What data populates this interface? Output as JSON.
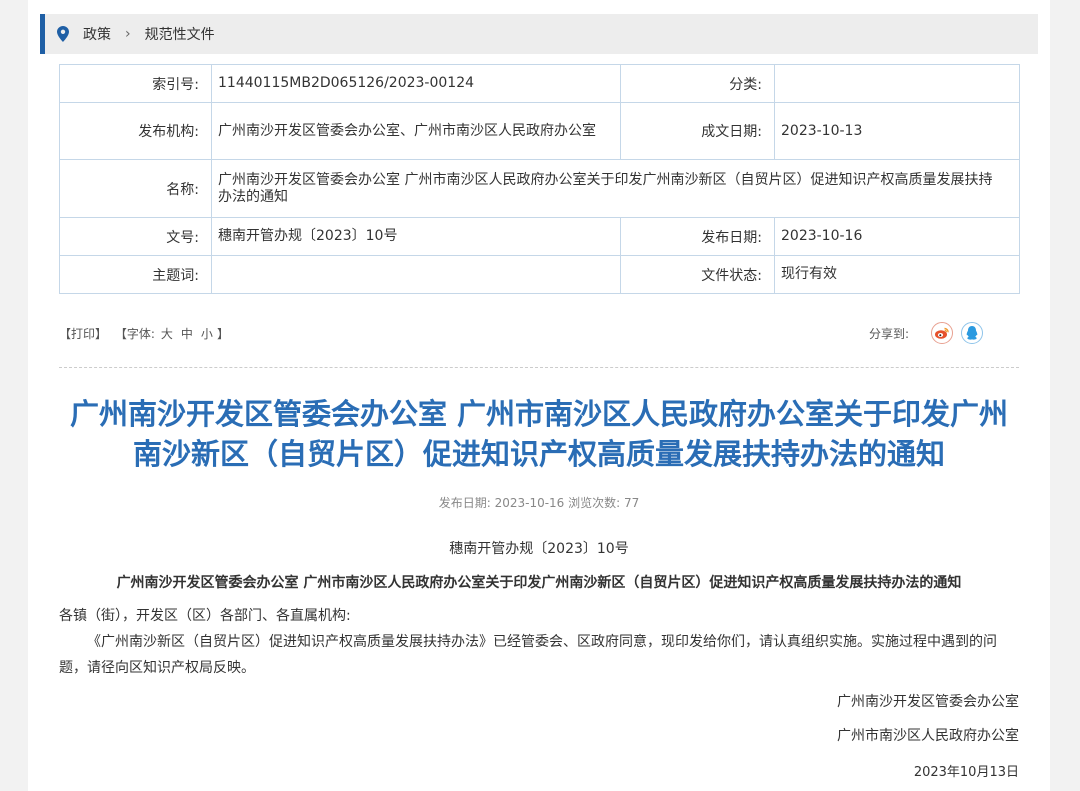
{
  "breadcrumb": {
    "items": [
      "政策",
      "规范性文件"
    ],
    "separator": "›"
  },
  "meta": {
    "index_label": "索引号:",
    "index_value": "11440115MB2D065126/2023-00124",
    "category_label": "分类:",
    "category_value": "",
    "publisher_label": "发布机构:",
    "publisher_value": "广州南沙开发区管委会办公室、广州市南沙区人民政府办公室",
    "created_label": "成文日期:",
    "created_value": "2023-10-13",
    "name_label": "名称:",
    "name_value": "广州南沙开发区管委会办公室 广州市南沙区人民政府办公室关于印发广州南沙新区（自贸片区）促进知识产权高质量发展扶持办法的通知",
    "docno_label": "文号:",
    "docno_value": "穗南开管办规〔2023〕10号",
    "published_label": "发布日期:",
    "published_value": "2023-10-16",
    "subject_label": "主题词:",
    "subject_value": "",
    "status_label": "文件状态:",
    "status_value": "现行有效"
  },
  "tools": {
    "print": "【打印】",
    "font_prefix": "【字体:",
    "font_large": "大",
    "font_medium": "中",
    "font_small": "小",
    "font_suffix": "】",
    "share_label": "分享到:"
  },
  "article": {
    "title": "广州南沙开发区管委会办公室 广州市南沙区人民政府办公室关于印发广州南沙新区（自贸片区）促进知识产权高质量发展扶持办法的通知",
    "pubinfo": "发布日期: 2023-10-16  浏览次数: 77",
    "docno": "穗南开管办规〔2023〕10号",
    "subtitle": "广州南沙开发区管委会办公室 广州市南沙区人民政府办公室关于印发广州南沙新区（自贸片区）促进知识产权高质量发展扶持办法的通知",
    "greeting": "各镇（街），开发区（区）各部门、各直属机构:",
    "paragraph": "《广州南沙新区（自贸片区）促进知识产权高质量发展扶持办法》已经管委会、区政府同意，现印发给你们，请认真组织实施。实施过程中遇到的问题，请径向区知识产权局反映。",
    "signature1": "广州南沙开发区管委会办公室",
    "signature2": "广州市南沙区人民政府办公室",
    "date": "2023年10月13日"
  },
  "colors": {
    "accent": "#1f5fa5",
    "title": "#2a6db5",
    "border": "#c5d7e8"
  }
}
